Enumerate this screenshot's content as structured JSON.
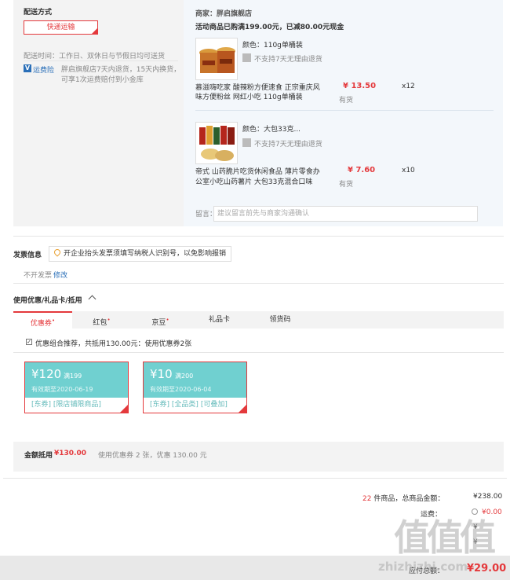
{
  "shipping": {
    "title": "配送方式",
    "button": "快递运输",
    "time_label": "配送时间：工作日、双休日与节假日均可送货",
    "insurance_badge": "V",
    "insurance_label": "运费险",
    "insurance_text_1": "胖启旗舰店7天内退货，15天内换货，",
    "insurance_text_2": "可享1次运费赔付到小金库"
  },
  "store": {
    "seller_label": "商家：胖启旗舰店",
    "promo": "活动商品已购满199.00元，已减80.00元现金",
    "items": [
      {
        "attr": "颜色：110g单桶装",
        "return_policy": "不支持7天无理由退货",
        "name_line1": "慕滋嗨吃家 酸辣粉方便速食 正宗重庆风",
        "name_line2": "味方便粉丝 网红小吃 110g单桶装",
        "price": "¥ 13.50",
        "stock": "有货",
        "qty": "x12"
      },
      {
        "attr": "颜色：大包33克...",
        "return_policy": "不支持7天无理由退货",
        "name_line1": "帝式 山药脆片吃货休闲食品 薄片零食办",
        "name_line2": "公室小吃山药薯片 大包33克混合口味",
        "price": "¥ 7.60",
        "stock": "有货",
        "qty": "x10"
      }
    ],
    "note_label": "留言：",
    "note_placeholder": "建议留言前先与商家沟通确认"
  },
  "invoice": {
    "title": "发票信息",
    "hint": "开企业抬头发票须填写纳税人识别号，以免影响报销",
    "value": "不开发票",
    "edit": "修改"
  },
  "discount": {
    "title": "使用优惠/礼品卡/抵用",
    "tabs": [
      "优惠券",
      "红包",
      "京豆",
      "礼品卡",
      "领货码"
    ],
    "tab_dots": [
      "•",
      "•",
      "•",
      "",
      ""
    ],
    "recommend": "优惠组合推荐，共抵用130.00元：使用优惠券2张",
    "coupons": [
      {
        "amount": "¥120",
        "cond": "满199",
        "valid": "有效期至2020-06-19",
        "tag1": "[东券]",
        "tag2": "[限店铺限商品]",
        "tag3": ""
      },
      {
        "amount": "¥10",
        "cond": "满200",
        "valid": "有效期至2020-06-04",
        "tag1": "[东券]",
        "tag2": "[全品类]",
        "tag3": "[可叠加]"
      }
    ],
    "summary_label": "金额抵用",
    "summary_amount": "¥130.00",
    "summary_desc": "使用优惠券 2 张，优惠 130.00 元"
  },
  "totals": {
    "count": "22",
    "count_suffix": "件商品，总商品金额：",
    "goods_amount": "¥238.00",
    "freight_label": "运费：",
    "freight_value": "¥0.00",
    "row3_value": "¥",
    "row4_value": "¥",
    "payable_label": "应付总额：",
    "payable_value": "¥29.00"
  },
  "watermark": {
    "logo": "值值值",
    "url": "zhizhizhi.com"
  }
}
